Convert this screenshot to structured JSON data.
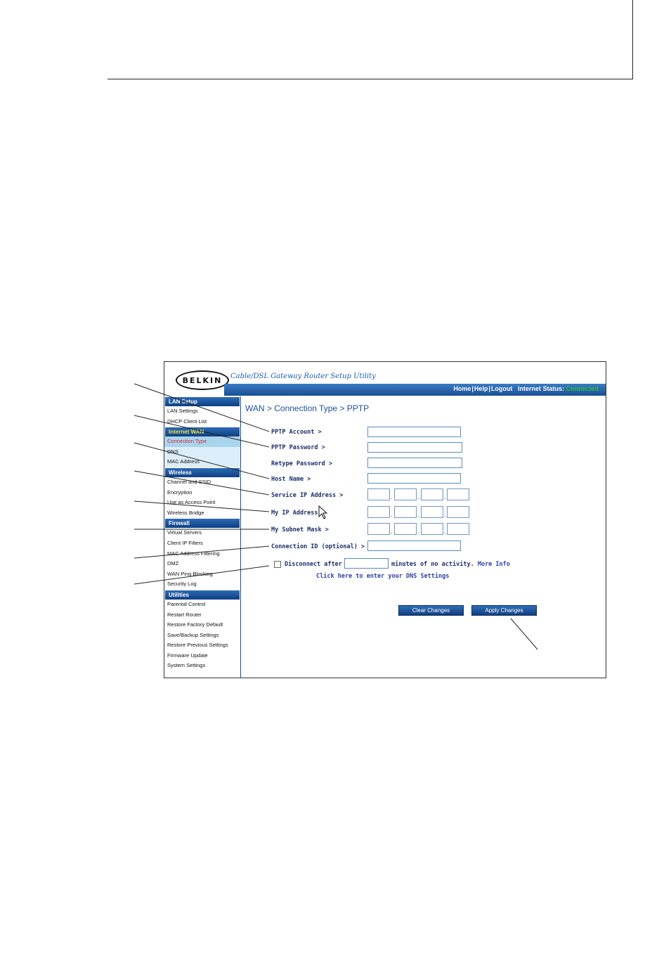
{
  "header": {
    "logo_text": "BELKIN",
    "utility_title": "Cable/DSL Gateway Router Setup Utility",
    "links": [
      "Home",
      "Help",
      "Logout"
    ],
    "status_label": "Internet Status:",
    "status_value": "Connected"
  },
  "sidebar": {
    "sections": [
      {
        "title": "LAN Setup",
        "items": [
          "LAN Settings",
          "DHCP Client List"
        ]
      },
      {
        "title": "Internet WAN",
        "items": [
          "Connection Type",
          "DNS",
          "MAC Address"
        ]
      },
      {
        "title": "Wireless",
        "items": [
          "Channel and SSID",
          "Encryption",
          "Use as Access Point",
          "Wireless Bridge"
        ]
      },
      {
        "title": "Firewall",
        "items": [
          "Virtual Servers",
          "Client IP Filters",
          "MAC Address Filtering",
          "DMZ",
          "WAN Ping Blocking",
          "Security Log"
        ]
      },
      {
        "title": "Utilities",
        "items": [
          "Parental Control",
          "Restart Router",
          "Restore Factory Default",
          "Save/Backup Settings",
          "Restore Previous Settings",
          "Firmware Update",
          "System Settings"
        ]
      }
    ],
    "active_item": "Connection Type"
  },
  "main": {
    "page_title": "WAN > Connection Type > PPTP",
    "fields": {
      "pptp_account": "PPTP Account >",
      "pptp_password": "PPTP Password >",
      "retype_password": "Retype Password >",
      "host_name": "Host Name >",
      "service_ip": "Service IP Address >",
      "my_ip": "My IP Address >",
      "subnet_mask": "My Subnet Mask >",
      "connection_id": "Connection ID (optional) >"
    },
    "disconnect_label": "Disconnect after",
    "disconnect_suffix": "minutes of no activity.",
    "more_info": "More Info",
    "dns_link": "Click here to enter your DNS Settings",
    "clear_button": "Clear Changes",
    "apply_button": "Apply Changes",
    "ip_separator": "."
  },
  "colors": {
    "accent_blue": "#1b4f92",
    "status_green": "#27c23a",
    "active_item_red": "#d8222a"
  }
}
